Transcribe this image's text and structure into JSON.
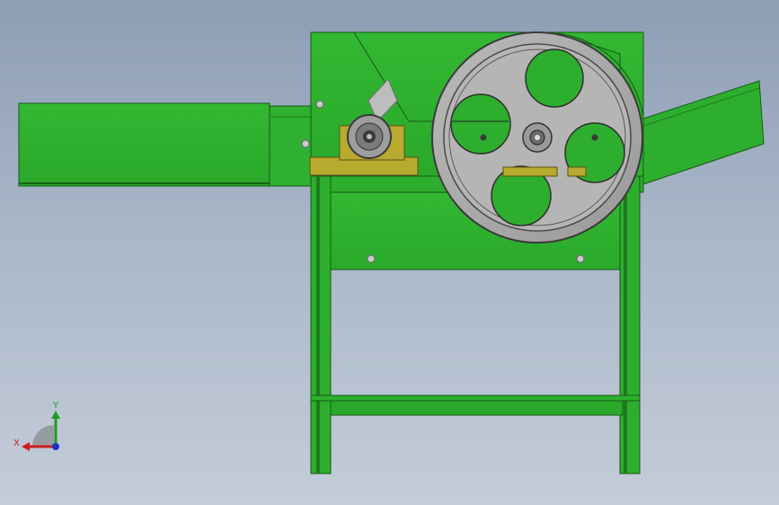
{
  "scene": {
    "description_colors": {
      "frame": "#2fb22f",
      "frame_dark": "#1e6e1e",
      "wheel": "#a8a8a8",
      "bearing_block": "#b8aa2e",
      "axis_x": "#c82020",
      "axis_y": "#19a019",
      "axis_z": "#2030c8"
    }
  },
  "triad": {
    "x_label": "X",
    "y_label": "Y"
  }
}
